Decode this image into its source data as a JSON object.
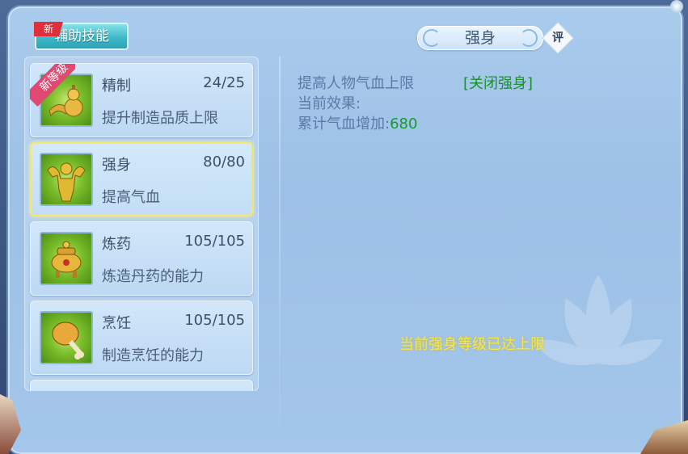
{
  "header": {
    "tab_label": "辅助技能",
    "new_badge": "新"
  },
  "skills": [
    {
      "name": "精制",
      "level": "24/25",
      "desc": "提升制造品质上限",
      "ribbon": "新等级",
      "icon": "gourd-icon"
    },
    {
      "name": "强身",
      "level": "80/80",
      "desc": "提高气血",
      "icon": "muscle-man-icon"
    },
    {
      "name": "炼药",
      "level": "105/105",
      "desc": "炼造丹药的能力",
      "icon": "incense-burner-icon"
    },
    {
      "name": "烹饪",
      "level": "105/105",
      "desc": "制造烹饪的能力",
      "icon": "drumstick-icon"
    }
  ],
  "detail": {
    "title": "强身",
    "rate_label": "评",
    "line1": "提高人物气血上限",
    "toggle_link": "[关闭强身]",
    "line2": "当前效果:",
    "line3_label": "累计气血增加:",
    "line3_value": "680",
    "max_notice": "当前强身等级已达上限"
  },
  "colors": {
    "panel_bg": "#a3c6ea",
    "selected_border": "#f4e86a",
    "green_text": "#18912b",
    "notice_yellow": "#f2e84a"
  }
}
